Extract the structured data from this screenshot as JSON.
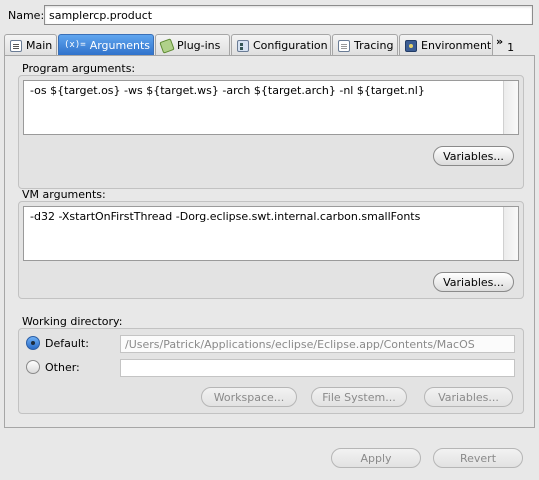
{
  "name_field": {
    "label": "Name:",
    "value": "samplercp.product"
  },
  "tabs": [
    {
      "label": "Main",
      "icon": "main-tab-icon",
      "active": false
    },
    {
      "label": "Arguments",
      "icon_text": "(x)=",
      "icon": "arguments-icon",
      "active": true
    },
    {
      "label": "Plug-ins",
      "icon": "plugin-icon",
      "active": false
    },
    {
      "label": "Configuration",
      "icon": "configuration-icon",
      "active": false
    },
    {
      "label": "Tracing",
      "icon": "tracing-icon",
      "active": false
    },
    {
      "label": "Environment",
      "icon": "environment-icon",
      "active": false
    }
  ],
  "tab_overflow": {
    "chevron": "»",
    "count": "1"
  },
  "program_arguments": {
    "label": "Program arguments:",
    "value": "-os ${target.os} -ws ${target.ws} -arch ${target.arch} -nl ${target.nl}",
    "variables_button": "Variables..."
  },
  "vm_arguments": {
    "label": "VM arguments:",
    "value": "-d32 -XstartOnFirstThread -Dorg.eclipse.swt.internal.carbon.smallFonts",
    "variables_button": "Variables..."
  },
  "working_directory": {
    "label": "Working directory:",
    "default_label": "Default:",
    "default_value": "/Users/Patrick/Applications/eclipse/Eclipse.app/Contents/MacOS",
    "other_label": "Other:",
    "other_value": "",
    "selected": "default",
    "buttons": {
      "workspace": "Workspace...",
      "file_system": "File System...",
      "variables": "Variables..."
    }
  },
  "footer": {
    "apply": "Apply",
    "revert": "Revert"
  },
  "colors": {
    "active_tab": "#2d6fc9",
    "background": "#e8e8e8"
  }
}
